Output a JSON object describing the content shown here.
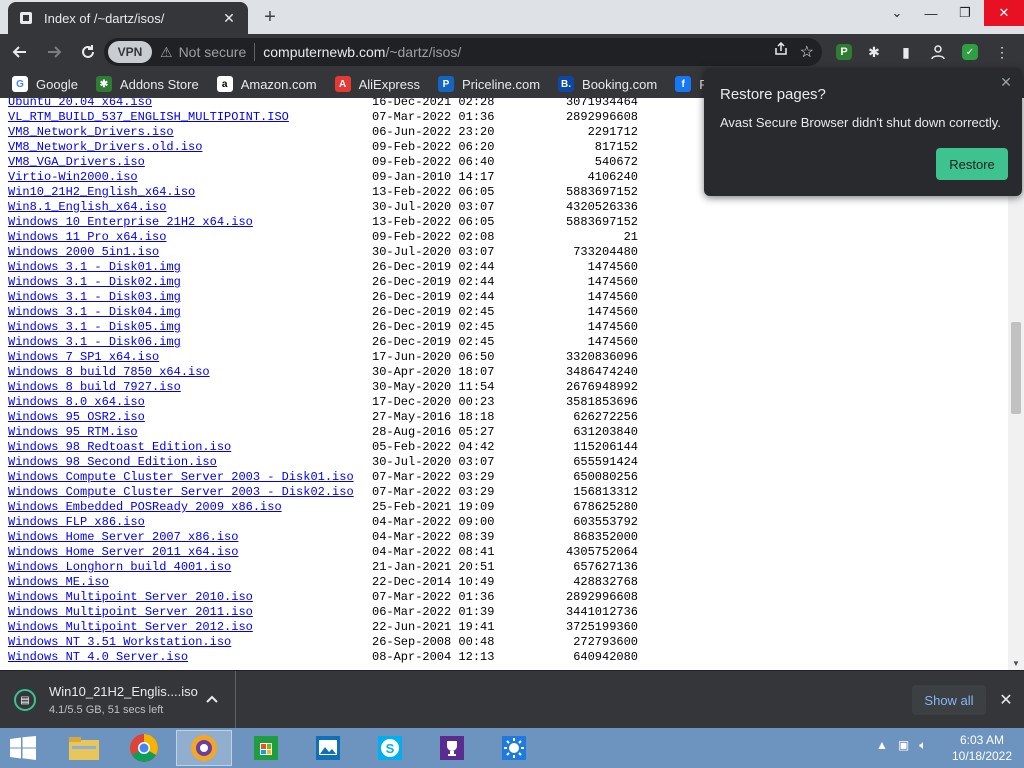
{
  "browser": {
    "tab_title": "Index of /~dartz/isos/",
    "url_host": "computernewb.com",
    "url_path": "/~dartz/isos/",
    "security_text": "Not secure",
    "vpn_label": "VPN"
  },
  "bookmarks": [
    {
      "label": "Google",
      "icon": "google-icon",
      "color": "#ffffff"
    },
    {
      "label": "Addons Store",
      "icon": "puzzle-icon",
      "color": "#2e7d32"
    },
    {
      "label": "Amazon.com",
      "icon": "amazon-icon",
      "color": "#ffffff"
    },
    {
      "label": "AliExpress",
      "icon": "aliexpress-icon",
      "color": "#e53935"
    },
    {
      "label": "Priceline.com",
      "icon": "priceline-icon",
      "color": "#1565c0"
    },
    {
      "label": "Booking.com",
      "icon": "booking-icon",
      "color": "#0d47a1"
    },
    {
      "label": "Facebook",
      "icon": "facebook-icon",
      "color": "#1877f2"
    }
  ],
  "restore_popup": {
    "title": "Restore pages?",
    "message": "Avast Secure Browser didn't shut down correctly.",
    "button": "Restore"
  },
  "listing": [
    {
      "name": "Ubuntu 20.04 x64.iso",
      "date": "16-Dec-2021 02:28",
      "size": "3071934464"
    },
    {
      "name": "VL_RTM_BUILD_537_ENGLISH_MULTIPOINT.ISO",
      "date": "07-Mar-2022 01:36",
      "size": "2892996608"
    },
    {
      "name": "VM8_Network_Drivers.iso",
      "date": "06-Jun-2022 23:20",
      "size": "2291712"
    },
    {
      "name": "VM8_Network_Drivers.old.iso",
      "date": "09-Feb-2022 06:20",
      "size": "817152"
    },
    {
      "name": "VM8_VGA_Drivers.iso",
      "date": "09-Feb-2022 06:40",
      "size": "540672"
    },
    {
      "name": "Virtio-Win2000.iso",
      "date": "09-Jan-2010 14:17",
      "size": "4106240"
    },
    {
      "name": "Win10_21H2_English_x64.iso",
      "date": "13-Feb-2022 06:05",
      "size": "5883697152"
    },
    {
      "name": "Win8.1_English_x64.iso",
      "date": "30-Jul-2020 03:07",
      "size": "4320526336"
    },
    {
      "name": "Windows 10 Enterprise 21H2 x64.iso",
      "date": "13-Feb-2022 06:05",
      "size": "5883697152"
    },
    {
      "name": "Windows 11 Pro x64.iso",
      "date": "09-Feb-2022 02:08",
      "size": "21"
    },
    {
      "name": "Windows 2000 5in1.iso",
      "date": "30-Jul-2020 03:07",
      "size": "733204480"
    },
    {
      "name": "Windows 3.1 - Disk01.img",
      "date": "26-Dec-2019 02:44",
      "size": "1474560"
    },
    {
      "name": "Windows 3.1 - Disk02.img",
      "date": "26-Dec-2019 02:44",
      "size": "1474560"
    },
    {
      "name": "Windows 3.1 - Disk03.img",
      "date": "26-Dec-2019 02:44",
      "size": "1474560"
    },
    {
      "name": "Windows 3.1 - Disk04.img",
      "date": "26-Dec-2019 02:45",
      "size": "1474560"
    },
    {
      "name": "Windows 3.1 - Disk05.img",
      "date": "26-Dec-2019 02:45",
      "size": "1474560"
    },
    {
      "name": "Windows 3.1 - Disk06.img",
      "date": "26-Dec-2019 02:45",
      "size": "1474560"
    },
    {
      "name": "Windows 7 SP1 x64.iso",
      "date": "17-Jun-2020 06:50",
      "size": "3320836096"
    },
    {
      "name": "Windows 8 build 7850 x64.iso",
      "date": "30-Apr-2020 18:07",
      "size": "3486474240"
    },
    {
      "name": "Windows 8 build 7927.iso",
      "date": "30-May-2020 11:54",
      "size": "2676948992"
    },
    {
      "name": "Windows 8.0 x64.iso",
      "date": "17-Dec-2020 00:23",
      "size": "3581853696"
    },
    {
      "name": "Windows 95 OSR2.iso",
      "date": "27-May-2016 18:18",
      "size": "626272256"
    },
    {
      "name": "Windows 95 RTM.iso",
      "date": "28-Aug-2016 05:27",
      "size": "631203840"
    },
    {
      "name": "Windows 98 Redtoast Edition.iso",
      "date": "05-Feb-2022 04:42",
      "size": "115206144"
    },
    {
      "name": "Windows 98 Second Edition.iso",
      "date": "30-Jul-2020 03:07",
      "size": "655591424"
    },
    {
      "name": "Windows Compute Cluster Server 2003 - Disk01.iso",
      "date": "07-Mar-2022 03:29",
      "size": "650080256"
    },
    {
      "name": "Windows Compute Cluster Server 2003 - Disk02.iso",
      "date": "07-Mar-2022 03:29",
      "size": "156813312"
    },
    {
      "name": "Windows Embedded POSReady 2009 x86.iso",
      "date": "25-Feb-2021 19:09",
      "size": "678625280"
    },
    {
      "name": "Windows FLP x86.iso",
      "date": "04-Mar-2022 09:00",
      "size": "603553792"
    },
    {
      "name": "Windows Home Server 2007 x86.iso",
      "date": "04-Mar-2022 08:39",
      "size": "868352000"
    },
    {
      "name": "Windows Home Server 2011 x64.iso",
      "date": "04-Mar-2022 08:41",
      "size": "4305752064"
    },
    {
      "name": "Windows Longhorn build 4001.iso",
      "date": "21-Jan-2021 20:51",
      "size": "657627136"
    },
    {
      "name": "Windows ME.iso",
      "date": "22-Dec-2014 10:49",
      "size": "428832768"
    },
    {
      "name": "Windows Multipoint Server 2010.iso",
      "date": "07-Mar-2022 01:36",
      "size": "2892996608"
    },
    {
      "name": "Windows Multipoint Server 2011.iso",
      "date": "06-Mar-2022 01:39",
      "size": "3441012736"
    },
    {
      "name": "Windows Multipoint Server 2012.iso",
      "date": "22-Jun-2021 19:41",
      "size": "3725199360"
    },
    {
      "name": "Windows NT 3.51 Workstation.iso",
      "date": "26-Sep-2008 00:48",
      "size": "272793600"
    },
    {
      "name": "Windows NT 4.0 Server.iso",
      "date": "08-Apr-2004 12:13",
      "size": "640942080"
    }
  ],
  "download": {
    "filename": "Win10_21H2_Englis....iso",
    "status": "4.1/5.5 GB, 51 secs left",
    "show_all": "Show all"
  },
  "taskbar": {
    "apps": [
      "file-explorer-icon",
      "chrome-icon",
      "avast-browser-icon",
      "store-icon",
      "photos-icon",
      "skype-icon",
      "trophy-icon",
      "weather-icon"
    ],
    "active_app": "avast-browser-icon",
    "time": "6:03 AM",
    "date": "10/18/2022"
  },
  "colors": {
    "accent_green": "#3ec28f",
    "link_blue": "#0000ee",
    "taskbar": "#6d93bf",
    "browser_dark": "#35363a"
  }
}
